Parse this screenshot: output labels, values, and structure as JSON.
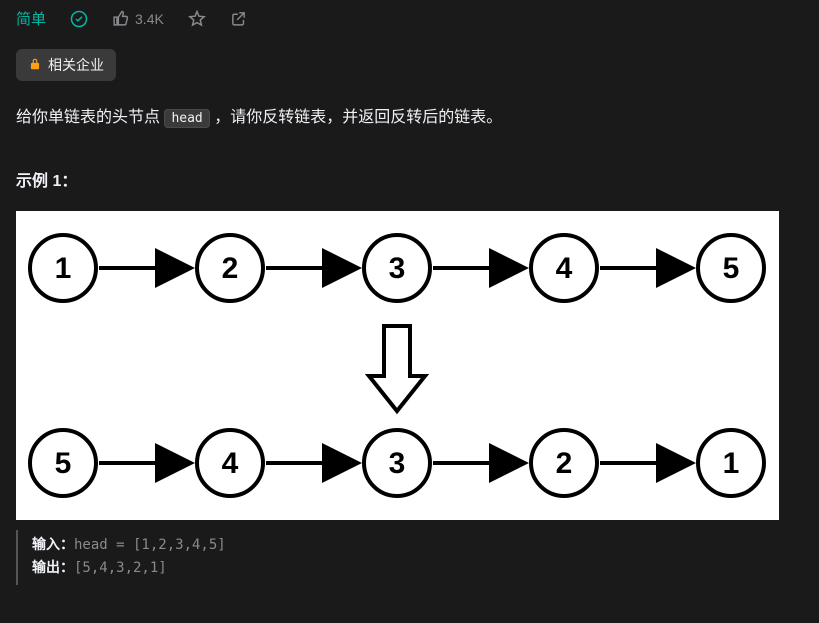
{
  "header": {
    "difficulty": "简单",
    "likes": "3.4K"
  },
  "companies": {
    "label": "相关企业"
  },
  "description": {
    "prefix": "给你单链表的头节点 ",
    "code": "head",
    "suffix": " ，请你反转链表，并返回反转后的链表。"
  },
  "example": {
    "title": "示例 1："
  },
  "diagram": {
    "top_nodes": [
      "1",
      "2",
      "3",
      "4",
      "5"
    ],
    "bottom_nodes": [
      "5",
      "4",
      "3",
      "2",
      "1"
    ]
  },
  "io": {
    "input_label": "输入：",
    "input_val": "head = [1,2,3,4,5]",
    "output_label": "输出：",
    "output_val": "[5,4,3,2,1]"
  }
}
